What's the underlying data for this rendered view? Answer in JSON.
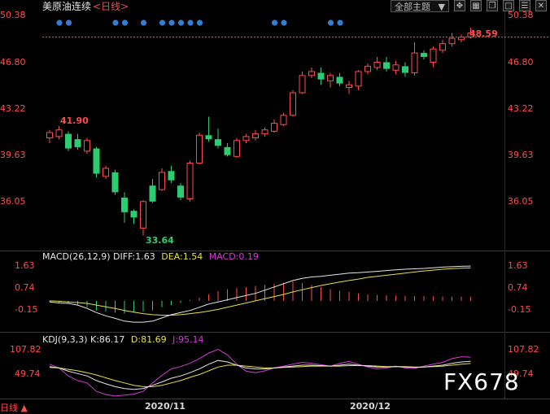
{
  "header": {
    "title": "美原油连续",
    "period": "<日线>",
    "theme_button": "全部主题",
    "theme_arrow": "▼"
  },
  "colors": {
    "up": "#ff4b4b",
    "down": "#2ecc71",
    "dif": "#e6e6e6",
    "dea": "#e8e23a",
    "macd": "#d43ad4",
    "event_dot": "#2f7fd6",
    "current_price_line": "#ff4b4b"
  },
  "price_axis": {
    "ticks": [
      "50.38",
      "46.80",
      "43.22",
      "39.63",
      "36.05"
    ],
    "current_price": "48.59",
    "annotations": {
      "high": "41.90",
      "low": "33.64"
    }
  },
  "macd_panel": {
    "label": "MACD(26,12,9)",
    "diff": "DIFF:1.63",
    "dea": "DEA:1.54",
    "macd": "MACD:0.19",
    "ticks": [
      "1.63",
      "0.74",
      "-0.15"
    ]
  },
  "kdj_panel": {
    "label": "KDJ(9,3,3)",
    "k": "K:86.17",
    "d": "D:81.69",
    "j": "J:95.14",
    "ticks": [
      "107.82",
      "49.74"
    ]
  },
  "dates": [
    "2020/11",
    "2020/12"
  ],
  "watermark": "FX678",
  "corner_label": "日线 ▲",
  "chart_data": {
    "type": "candlestick",
    "ylim": [
      33.0,
      50.9
    ],
    "candles": [
      {
        "o": 41.0,
        "h": 41.6,
        "l": 40.6,
        "c": 41.4,
        "up": true
      },
      {
        "o": 41.1,
        "h": 41.9,
        "l": 40.9,
        "c": 41.6,
        "up": true
      },
      {
        "o": 41.3,
        "h": 41.5,
        "l": 40.0,
        "c": 40.2,
        "up": false
      },
      {
        "o": 40.9,
        "h": 41.3,
        "l": 40.1,
        "c": 40.3,
        "up": false
      },
      {
        "o": 40.0,
        "h": 41.0,
        "l": 39.8,
        "c": 40.8,
        "up": true
      },
      {
        "o": 40.2,
        "h": 40.3,
        "l": 38.0,
        "c": 38.3,
        "up": false
      },
      {
        "o": 38.1,
        "h": 38.9,
        "l": 37.9,
        "c": 38.7,
        "up": true
      },
      {
        "o": 38.4,
        "h": 38.6,
        "l": 36.7,
        "c": 36.9,
        "up": false
      },
      {
        "o": 36.5,
        "h": 36.9,
        "l": 34.6,
        "c": 35.4,
        "up": false
      },
      {
        "o": 35.5,
        "h": 35.6,
        "l": 34.5,
        "c": 35.0,
        "up": false
      },
      {
        "o": 34.2,
        "h": 36.3,
        "l": 33.64,
        "c": 36.2,
        "up": true
      },
      {
        "o": 36.2,
        "h": 37.9,
        "l": 36.1,
        "c": 37.4,
        "up": false
      },
      {
        "o": 37.1,
        "h": 38.7,
        "l": 37.0,
        "c": 38.4,
        "up": true
      },
      {
        "o": 38.5,
        "h": 38.9,
        "l": 37.6,
        "c": 37.8,
        "up": false
      },
      {
        "o": 37.4,
        "h": 37.6,
        "l": 36.3,
        "c": 36.5,
        "up": false
      },
      {
        "o": 36.4,
        "h": 39.3,
        "l": 36.2,
        "c": 39.1,
        "up": true
      },
      {
        "o": 39.1,
        "h": 41.4,
        "l": 39.0,
        "c": 41.2,
        "up": true
      },
      {
        "o": 41.2,
        "h": 42.6,
        "l": 40.7,
        "c": 40.9,
        "up": false
      },
      {
        "o": 40.9,
        "h": 41.7,
        "l": 40.2,
        "c": 40.4,
        "up": false
      },
      {
        "o": 40.3,
        "h": 40.6,
        "l": 39.6,
        "c": 39.7,
        "up": false
      },
      {
        "o": 39.6,
        "h": 41.0,
        "l": 39.5,
        "c": 40.8,
        "up": true
      },
      {
        "o": 40.8,
        "h": 41.3,
        "l": 40.6,
        "c": 41.1,
        "up": true
      },
      {
        "o": 41.0,
        "h": 41.6,
        "l": 40.8,
        "c": 41.3,
        "up": true
      },
      {
        "o": 41.3,
        "h": 41.8,
        "l": 41.1,
        "c": 41.6,
        "up": true
      },
      {
        "o": 41.5,
        "h": 42.4,
        "l": 41.4,
        "c": 42.1,
        "up": true
      },
      {
        "o": 42.0,
        "h": 42.9,
        "l": 41.9,
        "c": 42.7,
        "up": true
      },
      {
        "o": 42.7,
        "h": 44.6,
        "l": 42.6,
        "c": 44.4,
        "up": true
      },
      {
        "o": 44.4,
        "h": 46.0,
        "l": 44.3,
        "c": 45.7,
        "up": true
      },
      {
        "o": 45.7,
        "h": 46.3,
        "l": 45.5,
        "c": 46.0,
        "up": true
      },
      {
        "o": 45.9,
        "h": 46.3,
        "l": 45.0,
        "c": 45.4,
        "up": false
      },
      {
        "o": 45.3,
        "h": 45.9,
        "l": 44.8,
        "c": 45.7,
        "up": true
      },
      {
        "o": 45.6,
        "h": 45.9,
        "l": 44.9,
        "c": 45.1,
        "up": false
      },
      {
        "o": 44.8,
        "h": 45.3,
        "l": 44.3,
        "c": 45.0,
        "up": true
      },
      {
        "o": 44.9,
        "h": 46.1,
        "l": 44.6,
        "c": 46.0,
        "up": true
      },
      {
        "o": 46.0,
        "h": 46.6,
        "l": 45.8,
        "c": 46.4,
        "up": true
      },
      {
        "o": 46.3,
        "h": 47.1,
        "l": 46.1,
        "c": 46.7,
        "up": true
      },
      {
        "o": 46.7,
        "h": 47.1,
        "l": 46.0,
        "c": 46.2,
        "up": false
      },
      {
        "o": 46.1,
        "h": 46.8,
        "l": 45.8,
        "c": 46.5,
        "up": true
      },
      {
        "o": 46.4,
        "h": 46.7,
        "l": 45.6,
        "c": 45.9,
        "up": false
      },
      {
        "o": 45.9,
        "h": 48.2,
        "l": 45.7,
        "c": 47.4,
        "up": true
      },
      {
        "o": 47.4,
        "h": 47.6,
        "l": 46.9,
        "c": 47.1,
        "up": false
      },
      {
        "o": 46.7,
        "h": 47.9,
        "l": 46.3,
        "c": 47.7,
        "up": true
      },
      {
        "o": 47.6,
        "h": 48.4,
        "l": 47.4,
        "c": 48.1,
        "up": true
      },
      {
        "o": 48.1,
        "h": 48.9,
        "l": 47.9,
        "c": 48.5,
        "up": true
      },
      {
        "o": 48.4,
        "h": 48.8,
        "l": 48.2,
        "c": 48.59,
        "up": true
      },
      {
        "o": 48.6,
        "h": 49.3,
        "l": 48.5,
        "c": 48.9,
        "up": true
      }
    ],
    "event_dots_at": [
      0,
      1,
      6,
      7,
      9,
      11,
      12,
      13,
      14,
      15,
      23,
      24,
      29,
      30
    ],
    "macd": {
      "ylim": [
        -1.3,
        1.9
      ],
      "dif": [
        -0.05,
        -0.1,
        -0.12,
        -0.2,
        -0.35,
        -0.55,
        -0.7,
        -0.82,
        -0.95,
        -1.0,
        -1.0,
        -0.95,
        -0.8,
        -0.65,
        -0.55,
        -0.45,
        -0.3,
        -0.15,
        -0.05,
        0.05,
        0.15,
        0.25,
        0.35,
        0.5,
        0.65,
        0.8,
        0.95,
        1.05,
        1.12,
        1.15,
        1.2,
        1.25,
        1.3,
        1.32,
        1.35,
        1.38,
        1.42,
        1.45,
        1.48,
        1.5,
        1.52,
        1.55,
        1.58,
        1.6,
        1.62,
        1.63
      ],
      "dea": [
        0.0,
        -0.02,
        -0.05,
        -0.08,
        -0.12,
        -0.2,
        -0.28,
        -0.36,
        -0.45,
        -0.53,
        -0.6,
        -0.65,
        -0.67,
        -0.67,
        -0.65,
        -0.6,
        -0.55,
        -0.48,
        -0.4,
        -0.3,
        -0.2,
        -0.1,
        0.0,
        0.1,
        0.2,
        0.3,
        0.42,
        0.52,
        0.62,
        0.72,
        0.8,
        0.88,
        0.95,
        1.02,
        1.1,
        1.15,
        1.2,
        1.25,
        1.3,
        1.35,
        1.4,
        1.44,
        1.48,
        1.51,
        1.53,
        1.54
      ],
      "hist": [
        -0.05,
        -0.08,
        -0.1,
        -0.18,
        -0.3,
        -0.45,
        -0.5,
        -0.55,
        -0.6,
        -0.55,
        -0.5,
        -0.45,
        -0.3,
        -0.2,
        -0.1,
        0.05,
        0.15,
        0.3,
        0.45,
        0.55,
        0.6,
        0.65,
        0.7,
        0.75,
        0.8,
        0.85,
        0.9,
        0.85,
        0.75,
        0.65,
        0.55,
        0.48,
        0.42,
        0.35,
        0.3,
        0.28,
        0.26,
        0.25,
        0.24,
        0.22,
        0.22,
        0.21,
        0.2,
        0.2,
        0.19,
        0.19
      ]
    },
    "kdj": {
      "ylim": [
        10,
        125
      ],
      "k": [
        75,
        72,
        65,
        60,
        55,
        45,
        38,
        32,
        28,
        26,
        28,
        35,
        42,
        50,
        55,
        62,
        70,
        80,
        88,
        85,
        78,
        72,
        70,
        70,
        72,
        74,
        76,
        78,
        78,
        77,
        76,
        78,
        80,
        78,
        76,
        74,
        74,
        75,
        74,
        73,
        74,
        76,
        78,
        82,
        85,
        86.17
      ],
      "d": [
        73,
        72,
        69,
        66,
        62,
        57,
        51,
        45,
        40,
        35,
        32,
        32,
        35,
        40,
        45,
        52,
        58,
        66,
        74,
        78,
        78,
        76,
        74,
        72,
        72,
        73,
        74,
        75,
        76,
        76,
        76,
        76,
        77,
        77,
        77,
        76,
        75,
        75,
        75,
        74,
        74,
        75,
        76,
        78,
        80,
        81.69
      ],
      "j": [
        80,
        72,
        55,
        45,
        40,
        22,
        15,
        12,
        14,
        16,
        22,
        40,
        56,
        70,
        75,
        82,
        92,
        104,
        112,
        100,
        80,
        65,
        62,
        66,
        72,
        76,
        80,
        84,
        82,
        79,
        76,
        82,
        86,
        80,
        74,
        70,
        72,
        76,
        72,
        71,
        76,
        80,
        84,
        92,
        96,
        95.14
      ]
    }
  }
}
